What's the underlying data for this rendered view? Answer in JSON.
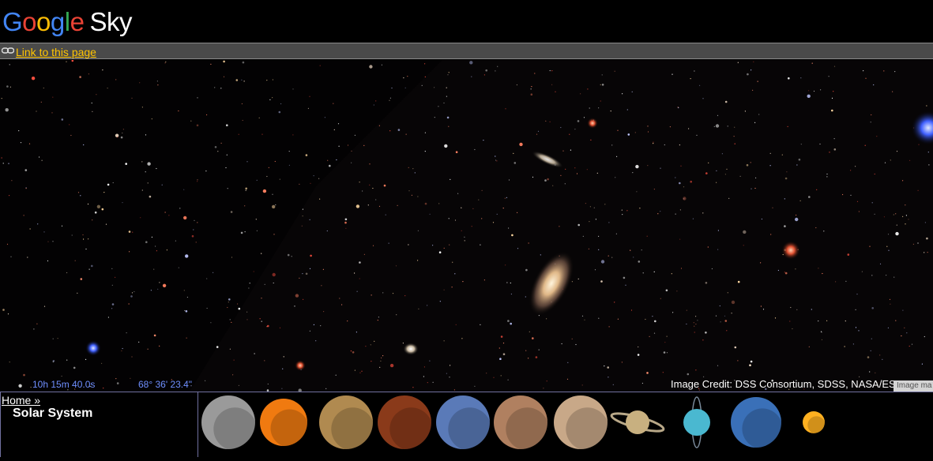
{
  "header": {
    "logo_google": [
      "G",
      "o",
      "o",
      "g",
      "l",
      "e"
    ],
    "logo_colors": [
      "#4285f4",
      "#ea4335",
      "#fbbc05",
      "#4285f4",
      "#34a853",
      "#ea4335"
    ],
    "logo_sky": "Sky"
  },
  "linkbar": {
    "icon": "link-icon",
    "link_text": "Link to this page",
    "link_color": "#ffc400"
  },
  "viewport": {
    "ra": "10h 15m 40.0s",
    "dec": "68° 36' 23.4\"",
    "credit": "Image Credit: DSS Consortium, SDSS, NASA/ESA",
    "credit_tag": "Image ma"
  },
  "bottom": {
    "home_link": "Home »",
    "section_title": "Solar System",
    "planets": [
      {
        "name": "moon-thumbnail",
        "color": "#9a9a9a"
      },
      {
        "name": "sun-thumbnail",
        "color": "#f07a10"
      },
      {
        "name": "mercury-thumbnail",
        "color": "#b08a50"
      },
      {
        "name": "venus-thumbnail",
        "color": "#8a3a1a"
      },
      {
        "name": "earth-thumbnail",
        "color": "#5a7ab8"
      },
      {
        "name": "mars-thumbnail",
        "color": "#b08060"
      },
      {
        "name": "jupiter-thumbnail",
        "color": "#c8a888"
      },
      {
        "name": "saturn-thumbnail",
        "color": "#c8b080"
      },
      {
        "name": "uranus-thumbnail",
        "color": "#4ab8d0"
      },
      {
        "name": "neptune-thumbnail",
        "color": "#3a70b8"
      },
      {
        "name": "pluto-thumbnail",
        "color": "#ffb020"
      }
    ]
  }
}
